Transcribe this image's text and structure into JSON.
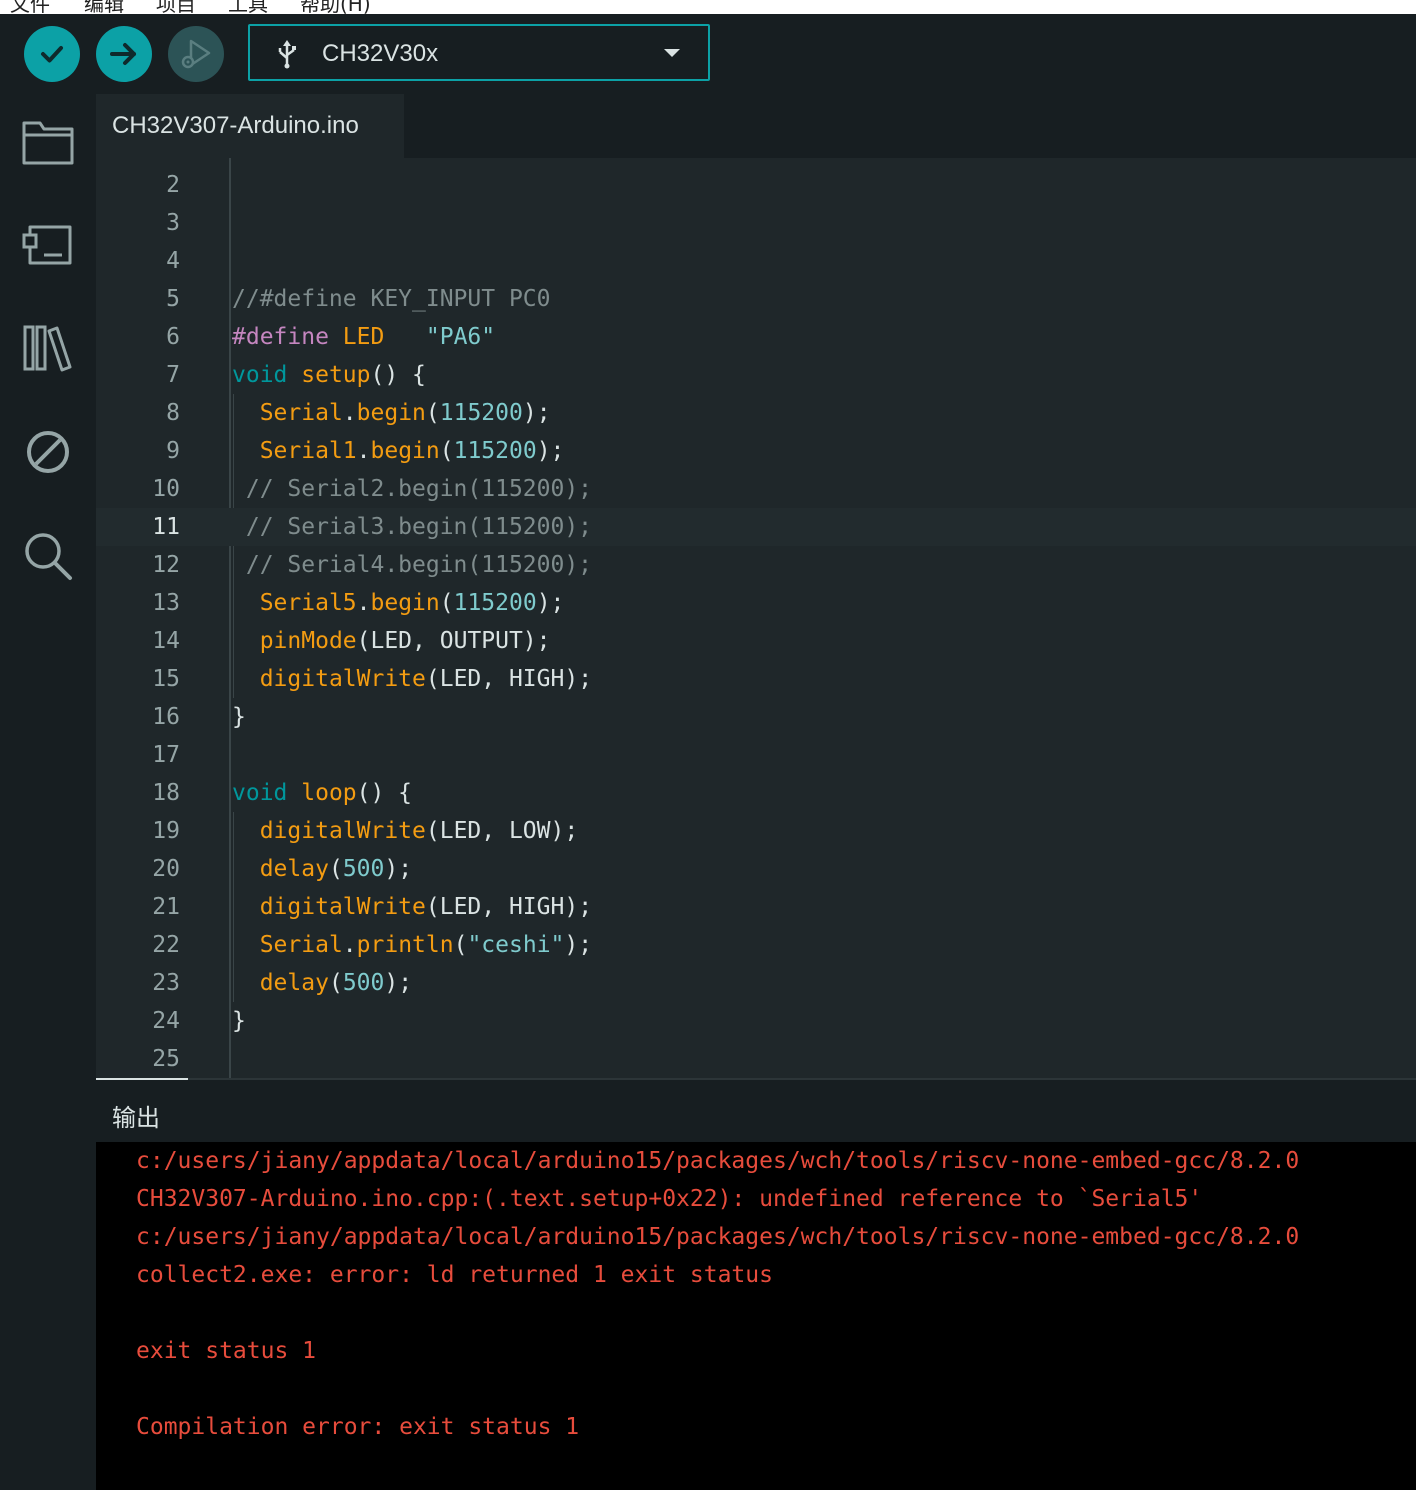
{
  "menu": {
    "items": [
      "文件",
      "编辑",
      "项目",
      "工具",
      "帮助(H)"
    ]
  },
  "toolbar": {
    "verify_icon": "check-icon",
    "upload_icon": "arrow-right-icon",
    "debug_icon": "debug-play-icon",
    "board_name": "CH32V30x",
    "board_icon": "usb-icon"
  },
  "sidebar": {
    "items": [
      {
        "name": "sketchbook",
        "icon": "folder-icon"
      },
      {
        "name": "boards-manager",
        "icon": "board-icon"
      },
      {
        "name": "library-manager",
        "icon": "library-icon"
      },
      {
        "name": "debug",
        "icon": "no-debug-icon"
      },
      {
        "name": "search",
        "icon": "search-icon"
      }
    ]
  },
  "editor": {
    "tab_label": "CH32V307-Arduino.ino",
    "current_line": 11,
    "lines": [
      {
        "n": "2",
        "tokens": []
      },
      {
        "n": "3",
        "tokens": []
      },
      {
        "n": "4",
        "tokens": []
      },
      {
        "n": "5",
        "tokens": [
          {
            "t": "//#define KEY_INPUT PC0",
            "c": "comment"
          }
        ]
      },
      {
        "n": "6",
        "tokens": [
          {
            "t": "#define",
            "c": "pre"
          },
          {
            "t": " ",
            "c": "plain"
          },
          {
            "t": "LED",
            "c": "macro"
          },
          {
            "t": "   ",
            "c": "plain"
          },
          {
            "t": "\"PA6\"",
            "c": "str"
          }
        ]
      },
      {
        "n": "7",
        "tokens": [
          {
            "t": "void",
            "c": "kw"
          },
          {
            "t": " ",
            "c": "plain"
          },
          {
            "t": "setup",
            "c": "fn"
          },
          {
            "t": "() {",
            "c": "plain"
          }
        ]
      },
      {
        "n": "8",
        "tokens": [
          {
            "t": "  ",
            "c": "plain"
          },
          {
            "t": "Serial",
            "c": "fn"
          },
          {
            "t": ".",
            "c": "plain"
          },
          {
            "t": "begin",
            "c": "fn"
          },
          {
            "t": "(",
            "c": "plain"
          },
          {
            "t": "115200",
            "c": "num"
          },
          {
            "t": ");",
            "c": "plain"
          }
        ]
      },
      {
        "n": "9",
        "tokens": [
          {
            "t": "  ",
            "c": "plain"
          },
          {
            "t": "Serial1",
            "c": "fn"
          },
          {
            "t": ".",
            "c": "plain"
          },
          {
            "t": "begin",
            "c": "fn"
          },
          {
            "t": "(",
            "c": "plain"
          },
          {
            "t": "115200",
            "c": "num"
          },
          {
            "t": ");",
            "c": "plain"
          }
        ]
      },
      {
        "n": "10",
        "tokens": [
          {
            "t": " // Serial2.begin(115200);",
            "c": "comment"
          }
        ]
      },
      {
        "n": "11",
        "tokens": [
          {
            "t": " // Serial3.begin(115200);",
            "c": "comment"
          }
        ]
      },
      {
        "n": "12",
        "tokens": [
          {
            "t": " // Serial4.begin(115200);",
            "c": "comment"
          }
        ]
      },
      {
        "n": "13",
        "tokens": [
          {
            "t": "  ",
            "c": "plain"
          },
          {
            "t": "Serial5",
            "c": "fn"
          },
          {
            "t": ".",
            "c": "plain"
          },
          {
            "t": "begin",
            "c": "fn"
          },
          {
            "t": "(",
            "c": "plain"
          },
          {
            "t": "115200",
            "c": "num"
          },
          {
            "t": ");",
            "c": "plain"
          }
        ]
      },
      {
        "n": "14",
        "tokens": [
          {
            "t": "  ",
            "c": "plain"
          },
          {
            "t": "pinMode",
            "c": "fn"
          },
          {
            "t": "(LED, OUTPUT);",
            "c": "plain"
          }
        ]
      },
      {
        "n": "15",
        "tokens": [
          {
            "t": "  ",
            "c": "plain"
          },
          {
            "t": "digitalWrite",
            "c": "fn"
          },
          {
            "t": "(LED, HIGH);",
            "c": "plain"
          }
        ]
      },
      {
        "n": "16",
        "tokens": [
          {
            "t": "}",
            "c": "plain"
          }
        ]
      },
      {
        "n": "17",
        "tokens": []
      },
      {
        "n": "18",
        "tokens": [
          {
            "t": "void",
            "c": "kw"
          },
          {
            "t": " ",
            "c": "plain"
          },
          {
            "t": "loop",
            "c": "fn"
          },
          {
            "t": "() {",
            "c": "plain"
          }
        ]
      },
      {
        "n": "19",
        "tokens": [
          {
            "t": "  ",
            "c": "plain"
          },
          {
            "t": "digitalWrite",
            "c": "fn"
          },
          {
            "t": "(LED, LOW);",
            "c": "plain"
          }
        ]
      },
      {
        "n": "20",
        "tokens": [
          {
            "t": "  ",
            "c": "plain"
          },
          {
            "t": "delay",
            "c": "fn"
          },
          {
            "t": "(",
            "c": "plain"
          },
          {
            "t": "500",
            "c": "num"
          },
          {
            "t": ");",
            "c": "plain"
          }
        ]
      },
      {
        "n": "21",
        "tokens": [
          {
            "t": "  ",
            "c": "plain"
          },
          {
            "t": "digitalWrite",
            "c": "fn"
          },
          {
            "t": "(LED, HIGH);",
            "c": "plain"
          }
        ]
      },
      {
        "n": "22",
        "tokens": [
          {
            "t": "  ",
            "c": "plain"
          },
          {
            "t": "Serial",
            "c": "fn"
          },
          {
            "t": ".",
            "c": "plain"
          },
          {
            "t": "println",
            "c": "fn"
          },
          {
            "t": "(",
            "c": "plain"
          },
          {
            "t": "\"ceshi\"",
            "c": "str"
          },
          {
            "t": ");",
            "c": "plain"
          }
        ]
      },
      {
        "n": "23",
        "tokens": [
          {
            "t": "  ",
            "c": "plain"
          },
          {
            "t": "delay",
            "c": "fn"
          },
          {
            "t": "(",
            "c": "plain"
          },
          {
            "t": "500",
            "c": "num"
          },
          {
            "t": ");",
            "c": "plain"
          }
        ]
      },
      {
        "n": "24",
        "tokens": [
          {
            "t": "}",
            "c": "plain"
          }
        ]
      },
      {
        "n": "25",
        "tokens": []
      }
    ]
  },
  "output": {
    "title": "输出",
    "lines": [
      "c:/users/jiany/appdata/local/arduino15/packages/wch/tools/riscv-none-embed-gcc/8.2.0",
      "CH32V307-Arduino.ino.cpp:(.text.setup+0x22): undefined reference to `Serial5'",
      "c:/users/jiany/appdata/local/arduino15/packages/wch/tools/riscv-none-embed-gcc/8.2.0",
      "collect2.exe: error: ld returned 1 exit status",
      "",
      "exit status 1",
      "",
      "Compilation error: exit status 1"
    ]
  },
  "colors": {
    "accent": "#0ca1a6",
    "error_text": "#e74c3c",
    "editor_bg": "#1f272a"
  }
}
